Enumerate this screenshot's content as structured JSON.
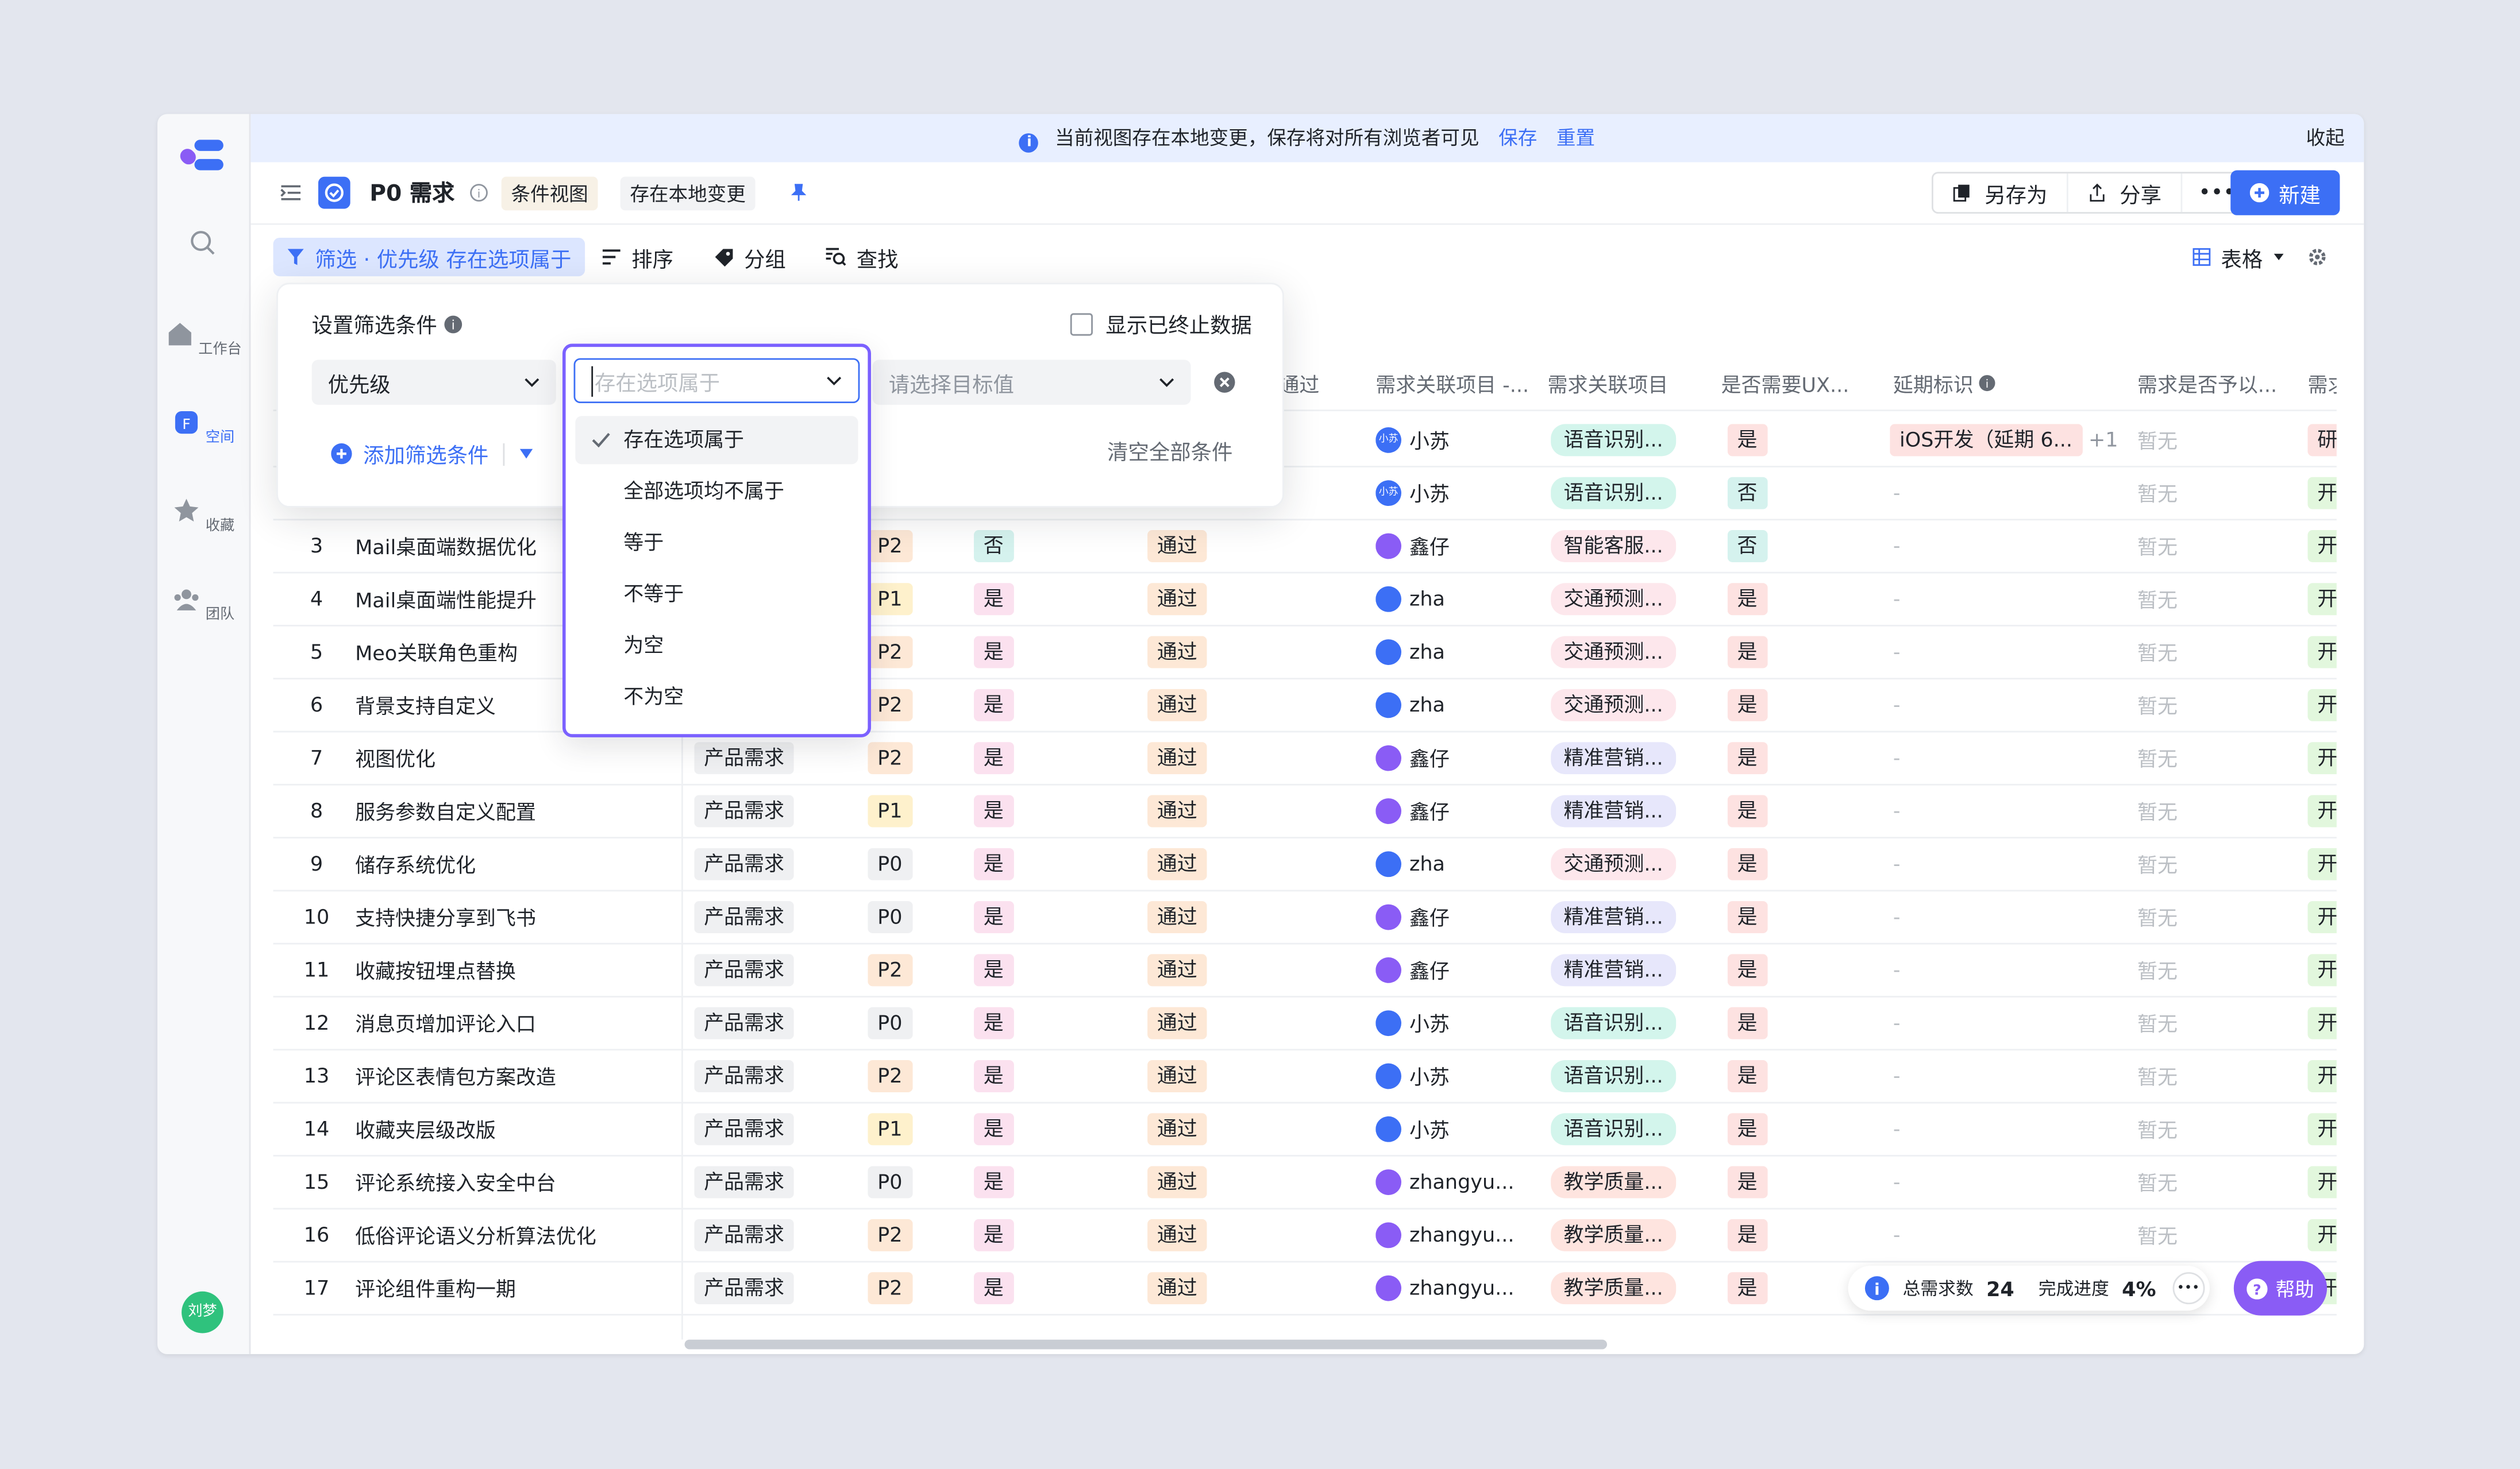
{
  "banner": {
    "message": "当前视图存在本地变更，保存将对所有浏览者可见",
    "save": "保存",
    "reset": "重置",
    "collapse": "收起"
  },
  "rail": {
    "items": [
      {
        "label": "工作台",
        "icon": "home-icon"
      },
      {
        "label": "空间",
        "icon": "space-icon"
      },
      {
        "label": "收藏",
        "icon": "star-icon"
      },
      {
        "label": "团队",
        "icon": "team-icon"
      }
    ],
    "user": "刘梦"
  },
  "titlebar": {
    "title": "P0 需求",
    "view_tag": "条件视图",
    "local_change_tag": "存在本地变更",
    "save_as": "另存为",
    "share": "分享",
    "new": "新建"
  },
  "toolbar": {
    "filter": "筛选 · 优先级 存在选项属于",
    "sort": "排序",
    "group": "分组",
    "find": "查找",
    "view_mode": "表格"
  },
  "filter_pop": {
    "title": "设置筛选条件",
    "show_terminated": "显示已终止数据",
    "field": "优先级",
    "operator_placeholder": "存在选项属于",
    "target_placeholder": "请选择目标值",
    "add": "添加筛选条件",
    "clear": "清空全部条件",
    "operators": [
      "存在选项属于",
      "全部选项均不属于",
      "等于",
      "不等于",
      "为空",
      "不为空"
    ],
    "selected": 0
  },
  "table": {
    "headers": [
      "通过",
      "需求关联项目 -...",
      "需求关联项目",
      "是否需要UX...",
      "延期标识",
      "需求是否予以...",
      "需求"
    ],
    "row1": {
      "user": "小苏",
      "project": "语音识别...",
      "ux": "是",
      "delay": "iOS开发（延期 6...",
      "delay_more": "+1",
      "grant": "暂无",
      "last": "研"
    },
    "row2": {
      "user": "小苏",
      "project": "语音识别...",
      "ux": "否",
      "delay": "-",
      "grant": "暂无",
      "last": "开"
    },
    "rows": [
      {
        "n": "3",
        "name": "Mail桌面端数据优化",
        "type": "",
        "pri": "P2",
        "yn": "否",
        "st": "通过",
        "user": "鑫仔",
        "av": "purple",
        "proj": "智能客服...",
        "pc": "p-pinkr",
        "ux": "否"
      },
      {
        "n": "4",
        "name": "Mail桌面端性能提升",
        "type": "",
        "pri": "P1",
        "yn": "是",
        "st": "通过",
        "user": "zha",
        "av": "blue",
        "proj": "交通预测...",
        "pc": "p-pinkr",
        "ux": "是"
      },
      {
        "n": "5",
        "name": "Meo关联角色重构",
        "type": "",
        "pri": "P2",
        "yn": "是",
        "st": "通过",
        "user": "zha",
        "av": "blue",
        "proj": "交通预测...",
        "pc": "p-pinkr",
        "ux": "是"
      },
      {
        "n": "6",
        "name": "背景支持自定义",
        "type": "",
        "pri": "P2",
        "yn": "是",
        "st": "通过",
        "user": "zha",
        "av": "blue",
        "proj": "交通预测...",
        "pc": "p-pinkr",
        "ux": "是"
      },
      {
        "n": "7",
        "name": "视图优化",
        "type": "产品需求",
        "pri": "P2",
        "yn": "是",
        "st": "通过",
        "user": "鑫仔",
        "av": "purple",
        "proj": "精准营销...",
        "pc": "p-lav",
        "ux": "是"
      },
      {
        "n": "8",
        "name": "服务参数自定义配置",
        "type": "产品需求",
        "pri": "P1",
        "yn": "是",
        "st": "通过",
        "user": "鑫仔",
        "av": "purple",
        "proj": "精准营销...",
        "pc": "p-lav",
        "ux": "是"
      },
      {
        "n": "9",
        "name": "储存系统优化",
        "type": "产品需求",
        "pri": "P0",
        "yn": "是",
        "st": "通过",
        "user": "zha",
        "av": "blue",
        "proj": "交通预测...",
        "pc": "p-pinkr",
        "ux": "是"
      },
      {
        "n": "10",
        "name": "支持快捷分享到飞书",
        "type": "产品需求",
        "pri": "P0",
        "yn": "是",
        "st": "通过",
        "user": "鑫仔",
        "av": "purple",
        "proj": "精准营销...",
        "pc": "p-lav",
        "ux": "是"
      },
      {
        "n": "11",
        "name": "收藏按钮埋点替换",
        "type": "产品需求",
        "pri": "P2",
        "yn": "是",
        "st": "通过",
        "user": "鑫仔",
        "av": "purple",
        "proj": "精准营销...",
        "pc": "p-lav",
        "ux": "是"
      },
      {
        "n": "12",
        "name": "消息页增加评论入口",
        "type": "产品需求",
        "pri": "P0",
        "yn": "是",
        "st": "通过",
        "user": "小苏",
        "av": "blue",
        "proj": "语音识别...",
        "pc": "p-mint",
        "ux": "是"
      },
      {
        "n": "13",
        "name": "评论区表情包方案改造",
        "type": "产品需求",
        "pri": "P2",
        "yn": "是",
        "st": "通过",
        "user": "小苏",
        "av": "blue",
        "proj": "语音识别...",
        "pc": "p-mint",
        "ux": "是"
      },
      {
        "n": "14",
        "name": "收藏夹层级改版",
        "type": "产品需求",
        "pri": "P1",
        "yn": "是",
        "st": "通过",
        "user": "小苏",
        "av": "blue",
        "proj": "语音识别...",
        "pc": "p-mint",
        "ux": "是"
      },
      {
        "n": "15",
        "name": "评论系统接入安全中台",
        "type": "产品需求",
        "pri": "P0",
        "yn": "是",
        "st": "通过",
        "user": "zhangyu...",
        "av": "purple",
        "proj": "教学质量...",
        "pc": "p-salm",
        "ux": "是"
      },
      {
        "n": "16",
        "name": "低俗评论语义分析算法优化",
        "type": "产品需求",
        "pri": "P2",
        "yn": "是",
        "st": "通过",
        "user": "zhangyu...",
        "av": "purple",
        "proj": "教学质量...",
        "pc": "p-salm",
        "ux": "是"
      },
      {
        "n": "17",
        "name": "评论组件重构一期",
        "type": "产品需求",
        "pri": "P2",
        "yn": "是",
        "st": "通过",
        "user": "zhangyu...",
        "av": "purple",
        "proj": "教学质量...",
        "pc": "p-salm",
        "ux": "是"
      }
    ],
    "empty": "-",
    "grant": "暂无",
    "last": "开"
  },
  "stats": {
    "total_label": "总需求数",
    "total": "24",
    "progress_label": "完成进度",
    "progress": "4%"
  },
  "help": "帮助"
}
